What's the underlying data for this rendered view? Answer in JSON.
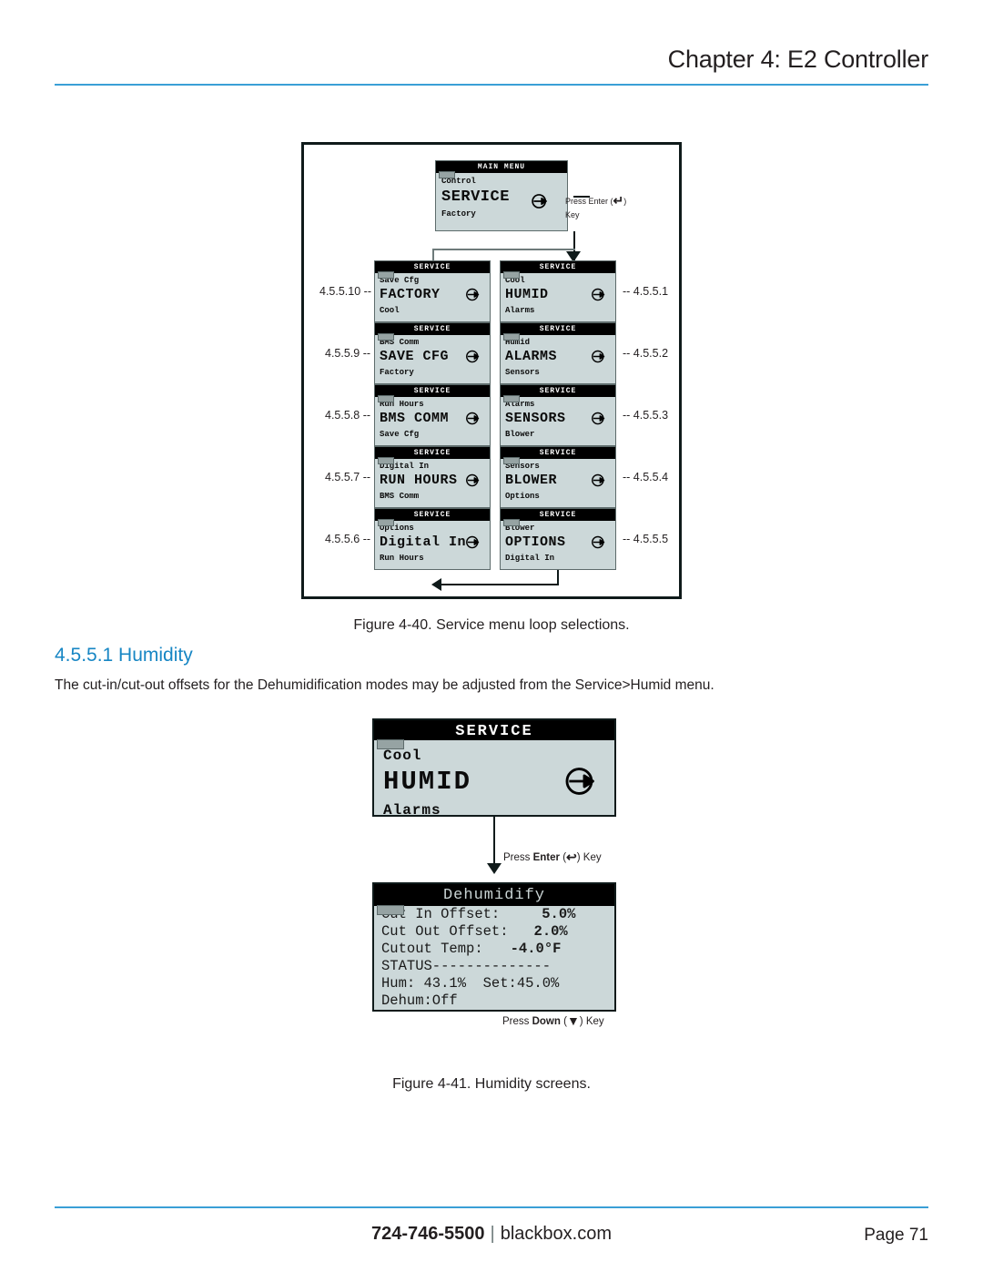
{
  "header": {
    "title": "Chapter 4: E2 Controller",
    "rule_color": "#3a9fd6"
  },
  "figure_40": {
    "caption": "Figure 4-40. Service menu loop selections.",
    "main_menu": {
      "bar": "MAIN MENU",
      "above": "Control",
      "selected": "SERVICE",
      "below": "Factory",
      "icon": "circle-right-arrow-icon"
    },
    "enter_note_line1": "Press Enter (",
    "enter_note_glyph": "↵",
    "enter_note_line1b": ")",
    "enter_note_line2": "Key",
    "left_column": [
      {
        "index": "4.5.5.10 --",
        "bar": "SERVICE",
        "above": "Save Cfg",
        "selected": "FACTORY",
        "below": "Cool"
      },
      {
        "index": "4.5.5.9 --",
        "bar": "SERVICE",
        "above": "BMS Comm",
        "selected": "SAVE CFG",
        "below": "Factory"
      },
      {
        "index": "4.5.5.8 --",
        "bar": "SERVICE",
        "above": "Run Hours",
        "selected": "BMS COMM",
        "below": "Save Cfg"
      },
      {
        "index": "4.5.5.7 --",
        "bar": "SERVICE",
        "above": "Digital In",
        "selected": "RUN HOURS",
        "below": "BMS Comm"
      },
      {
        "index": "4.5.5.6 --",
        "bar": "SERVICE",
        "above": "Options",
        "selected": "Digital In",
        "below": "Run Hours"
      }
    ],
    "right_column": [
      {
        "index": "-- 4.5.5.1",
        "bar": "SERVICE",
        "above": "Cool",
        "selected": "HUMID",
        "below": "Alarms"
      },
      {
        "index": "-- 4.5.5.2",
        "bar": "SERVICE",
        "above": "Humid",
        "selected": "ALARMS",
        "below": "Sensors"
      },
      {
        "index": "-- 4.5.5.3",
        "bar": "SERVICE",
        "above": "Alarms",
        "selected": "SENSORS",
        "below": "Blower"
      },
      {
        "index": "-- 4.5.5.4",
        "bar": "SERVICE",
        "above": "Sensors",
        "selected": "BLOWER",
        "below": "Options"
      },
      {
        "index": "-- 4.5.5.5",
        "bar": "SERVICE",
        "above": "Blower",
        "selected": "OPTIONS",
        "below": "Digital In"
      }
    ]
  },
  "section": {
    "heading": "4.5.5.1 Humidity",
    "heading_color": "#1786c4",
    "body": "The cut-in/cut-out offsets for the Dehumidification modes may be adjusted from the Service>Humid menu."
  },
  "figure_41": {
    "caption": "Figure 4-41. Humidity screens.",
    "humid_screen": {
      "bar": "SERVICE",
      "above": "Cool",
      "selected": "HUMID",
      "below": "Alarms",
      "icon": "circle-right-arrow-icon"
    },
    "enter_note_pre": "Press ",
    "enter_note_bold": "Enter",
    "enter_note_open": " (",
    "enter_note_glyph": "↩",
    "enter_note_close": ") ",
    "enter_note_post": "Key",
    "dehumidify_screen": {
      "bar": "Dehumidify",
      "lines": [
        {
          "label": "Cut In Offset:",
          "value": "5.0%"
        },
        {
          "label": "Cut Out Offset:",
          "value": "2.0%"
        },
        {
          "label": "Cutout Temp:",
          "value": "-4.0°F"
        }
      ],
      "status_line": "STATUS--------------",
      "readout_line": "Hum: 43.1%  Set:45.0%",
      "dehum_line": "Dehum:Off"
    },
    "down_note_pre": "Press ",
    "down_note_bold": "Down",
    "down_note_open": " (",
    "down_note_glyph": "▼",
    "down_note_close": ") ",
    "down_note_post": "Key"
  },
  "footer": {
    "phone": "724-746-5500",
    "separator": "|",
    "site": "blackbox.com",
    "page": "Page 71",
    "rule_color": "#3a9fd6"
  }
}
